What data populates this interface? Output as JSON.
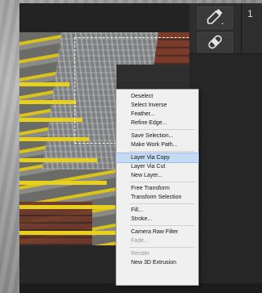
{
  "ruler": {
    "number": "1"
  },
  "icons": {
    "tool1": "eyedropper-icon",
    "tool2": "bandage-icon"
  },
  "context_menu": {
    "groups": [
      [
        {
          "label": "Deselect",
          "state": "normal"
        },
        {
          "label": "Select Inverse",
          "state": "normal"
        },
        {
          "label": "Feather...",
          "state": "normal"
        },
        {
          "label": "Refine Edge...",
          "state": "normal"
        }
      ],
      [
        {
          "label": "Save Selection...",
          "state": "normal"
        },
        {
          "label": "Make Work Path...",
          "state": "normal"
        }
      ],
      [
        {
          "label": "Layer Via Copy",
          "state": "highlighted"
        },
        {
          "label": "Layer Via Cut",
          "state": "normal"
        },
        {
          "label": "New Layer...",
          "state": "normal"
        }
      ],
      [
        {
          "label": "Free Transform",
          "state": "normal"
        },
        {
          "label": "Transform Selection",
          "state": "normal"
        }
      ],
      [
        {
          "label": "Fill...",
          "state": "normal"
        },
        {
          "label": "Stroke...",
          "state": "normal"
        }
      ],
      [
        {
          "label": "Camera Raw Filter",
          "state": "normal"
        },
        {
          "label": "Fade...",
          "state": "disabled"
        }
      ],
      [
        {
          "label": "Render",
          "state": "disabled"
        },
        {
          "label": "New 3D Extrusion",
          "state": "normal"
        }
      ]
    ]
  },
  "colors": {
    "highlight": "#c5dbf3",
    "menu_bg": "#f0f0f0",
    "app_bg": "#2b2b2b"
  }
}
